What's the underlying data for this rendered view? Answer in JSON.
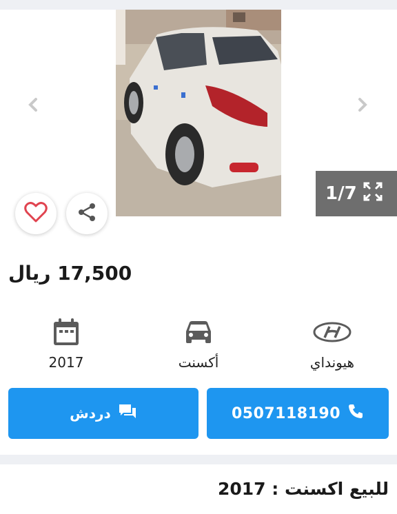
{
  "gallery": {
    "counter": "1/7"
  },
  "listing": {
    "price_value": "17,500",
    "price_currency": "ريال",
    "title": "للبيع اكسنت : 2017"
  },
  "specs": {
    "year": "2017",
    "model": "أكسنت",
    "brand": "هيونداي"
  },
  "actions": {
    "chat_label": "دردش",
    "phone_label": "0507118190"
  },
  "colors": {
    "primary_button": "#1e96f0",
    "favorite_heart": "#e0434f",
    "counter_bg": "#6e6e6e"
  },
  "icons": {
    "prev": "chevron-left-icon",
    "next": "chevron-right-icon",
    "fullscreen": "fullscreen-icon",
    "favorite": "heart-icon",
    "share": "share-icon",
    "year": "calendar-icon",
    "model": "car-icon",
    "brand": "hyundai-logo-icon",
    "chat": "chat-icon",
    "phone": "phone-icon"
  }
}
